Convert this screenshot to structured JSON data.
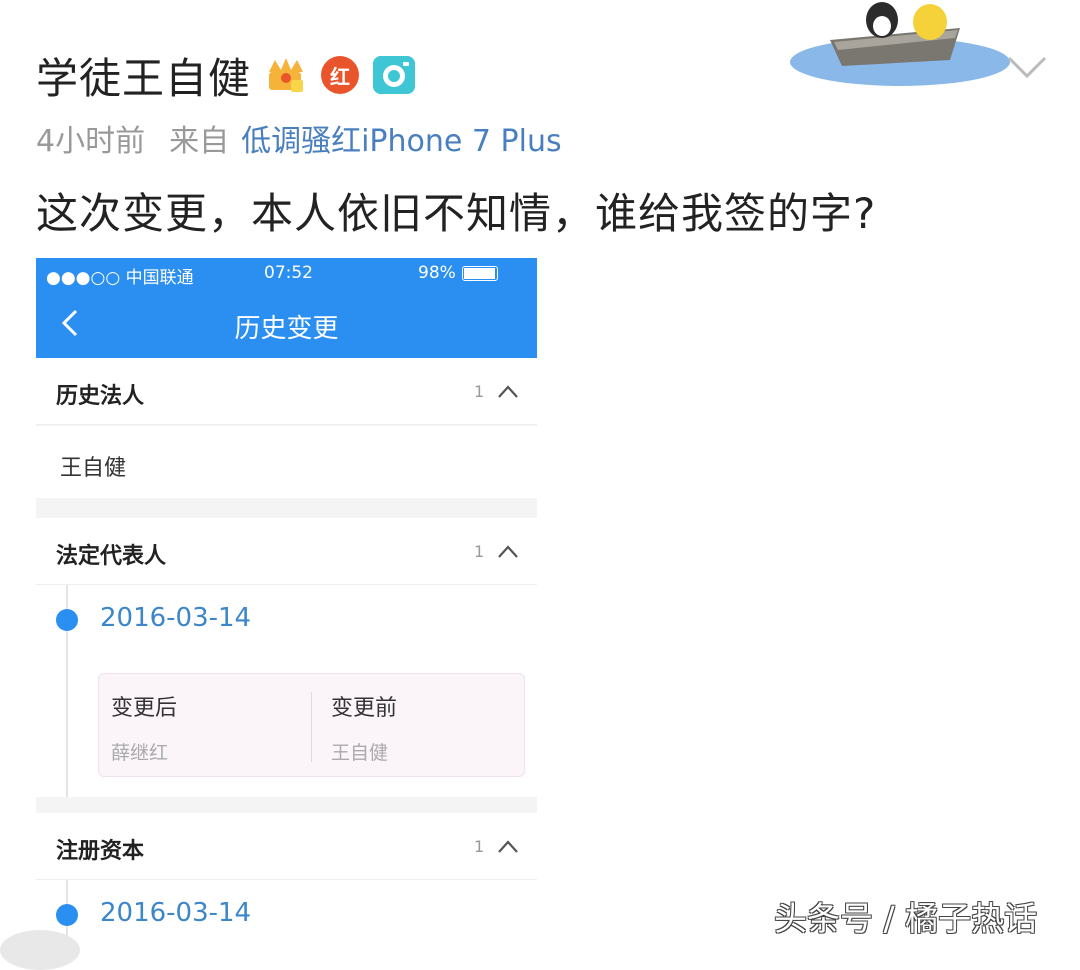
{
  "post": {
    "author": "学徒王自健",
    "badges": [
      "crown-icon",
      "red-v-icon",
      "camera-icon"
    ],
    "red_badge_text": "红",
    "time": "4小时前",
    "source_label": "来自",
    "source_device": "低调骚红iPhone 7 Plus",
    "text": "这次变更，本人依旧不知情，谁给我签的字?"
  },
  "phone": {
    "status": {
      "carrier": "●●●○○ 中国联通",
      "time": "07:52",
      "battery": "98%"
    },
    "nav_title": "历史变更",
    "sections": [
      {
        "title": "历史法人",
        "count": "1",
        "value": "王自健"
      },
      {
        "title": "法定代表人",
        "count": "1",
        "date": "2016-03-14",
        "after_label": "变更后",
        "after_value": "薛继红",
        "before_label": "变更前",
        "before_value": "王自健"
      },
      {
        "title": "注册资本",
        "count": "1",
        "date": "2016-03-14"
      }
    ]
  },
  "watermark": "头条号 / 橘子热话",
  "colors": {
    "app_blue": "#2b8ff2",
    "link_blue": "#4a7fbf",
    "date_blue": "#3c86c9"
  }
}
